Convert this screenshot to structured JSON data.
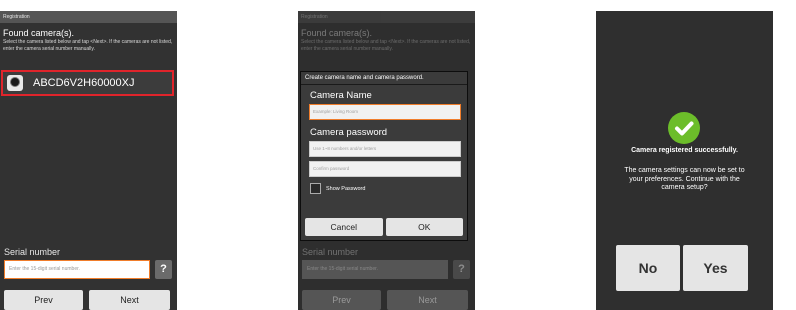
{
  "screen1": {
    "title": "Registration",
    "heading": "Found camera(s).",
    "instructions": "Select the camera listed below and tap <Next>. If the cameras are not listed, enter the camera serial number manually.",
    "camera_id": "ABCD6V2H60000XJ",
    "serial_label": "Serial number",
    "serial_placeholder": "Enter the 15-digit serial number.",
    "help_label": "?",
    "prev_label": "Prev",
    "next_label": "Next"
  },
  "screen2": {
    "title": "Registration",
    "heading": "Found camera(s).",
    "instructions": "Select the camera listed below and tap <Next>. If the cameras are not listed, enter the camera serial number manually.",
    "dialog": {
      "title": "Create camera name and camera password.",
      "name_heading": "Camera Name",
      "name_placeholder": "Example: Living Room",
      "password_heading": "Camera password",
      "password_placeholder": "Use 1~8 numbers and/or letters",
      "confirm_placeholder": "Confirm password",
      "show_password_label": "Show Password",
      "cancel_label": "Cancel",
      "ok_label": "OK"
    },
    "serial_label": "Serial number",
    "serial_placeholder": "Enter the 15-digit serial number.",
    "help_label": "?",
    "prev_label": "Prev",
    "next_label": "Next"
  },
  "screen3": {
    "title_line": "Camera registered successfully.",
    "message": "The camera settings can now be set to your preferences. Continue with the camera setup?",
    "no_label": "No",
    "yes_label": "Yes",
    "success_color": "#6cbd2a",
    "icons": [
      "checkmark-icon"
    ]
  },
  "colors": {
    "highlight": "#e0242b",
    "focus": "#f07d2b"
  }
}
